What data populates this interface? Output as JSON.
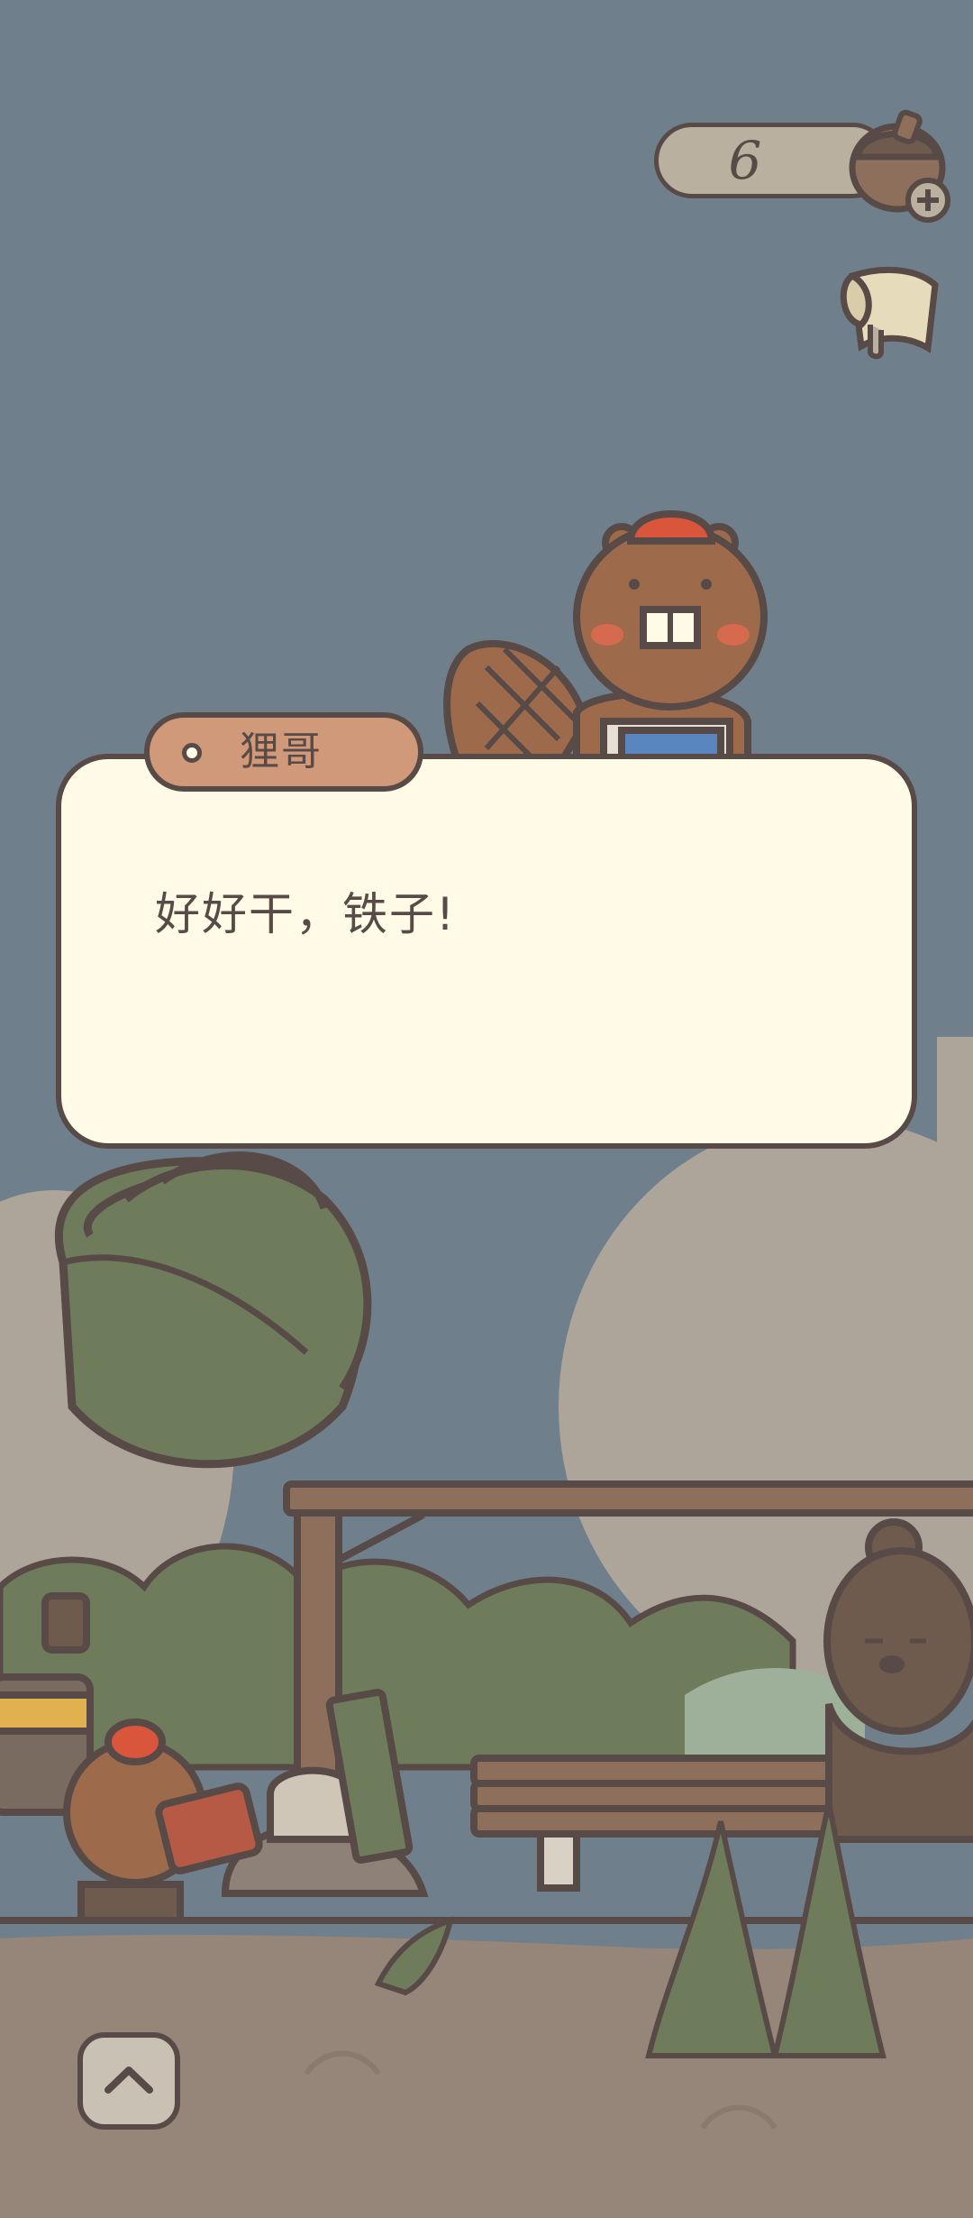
{
  "hud": {
    "acorn_count": "6",
    "icons": [
      "acorn-add-icon",
      "map-icon"
    ]
  },
  "dialog": {
    "speaker": "狸哥",
    "text": "好好干，铁子!"
  },
  "controls": {
    "expand_icon": "chevron-up-icon"
  },
  "colors": {
    "sky": "#6f7f8b",
    "outline": "#584a46",
    "dialog_bg": "#fffbe6",
    "name_tag": "#d09979",
    "ground": "#968679"
  }
}
